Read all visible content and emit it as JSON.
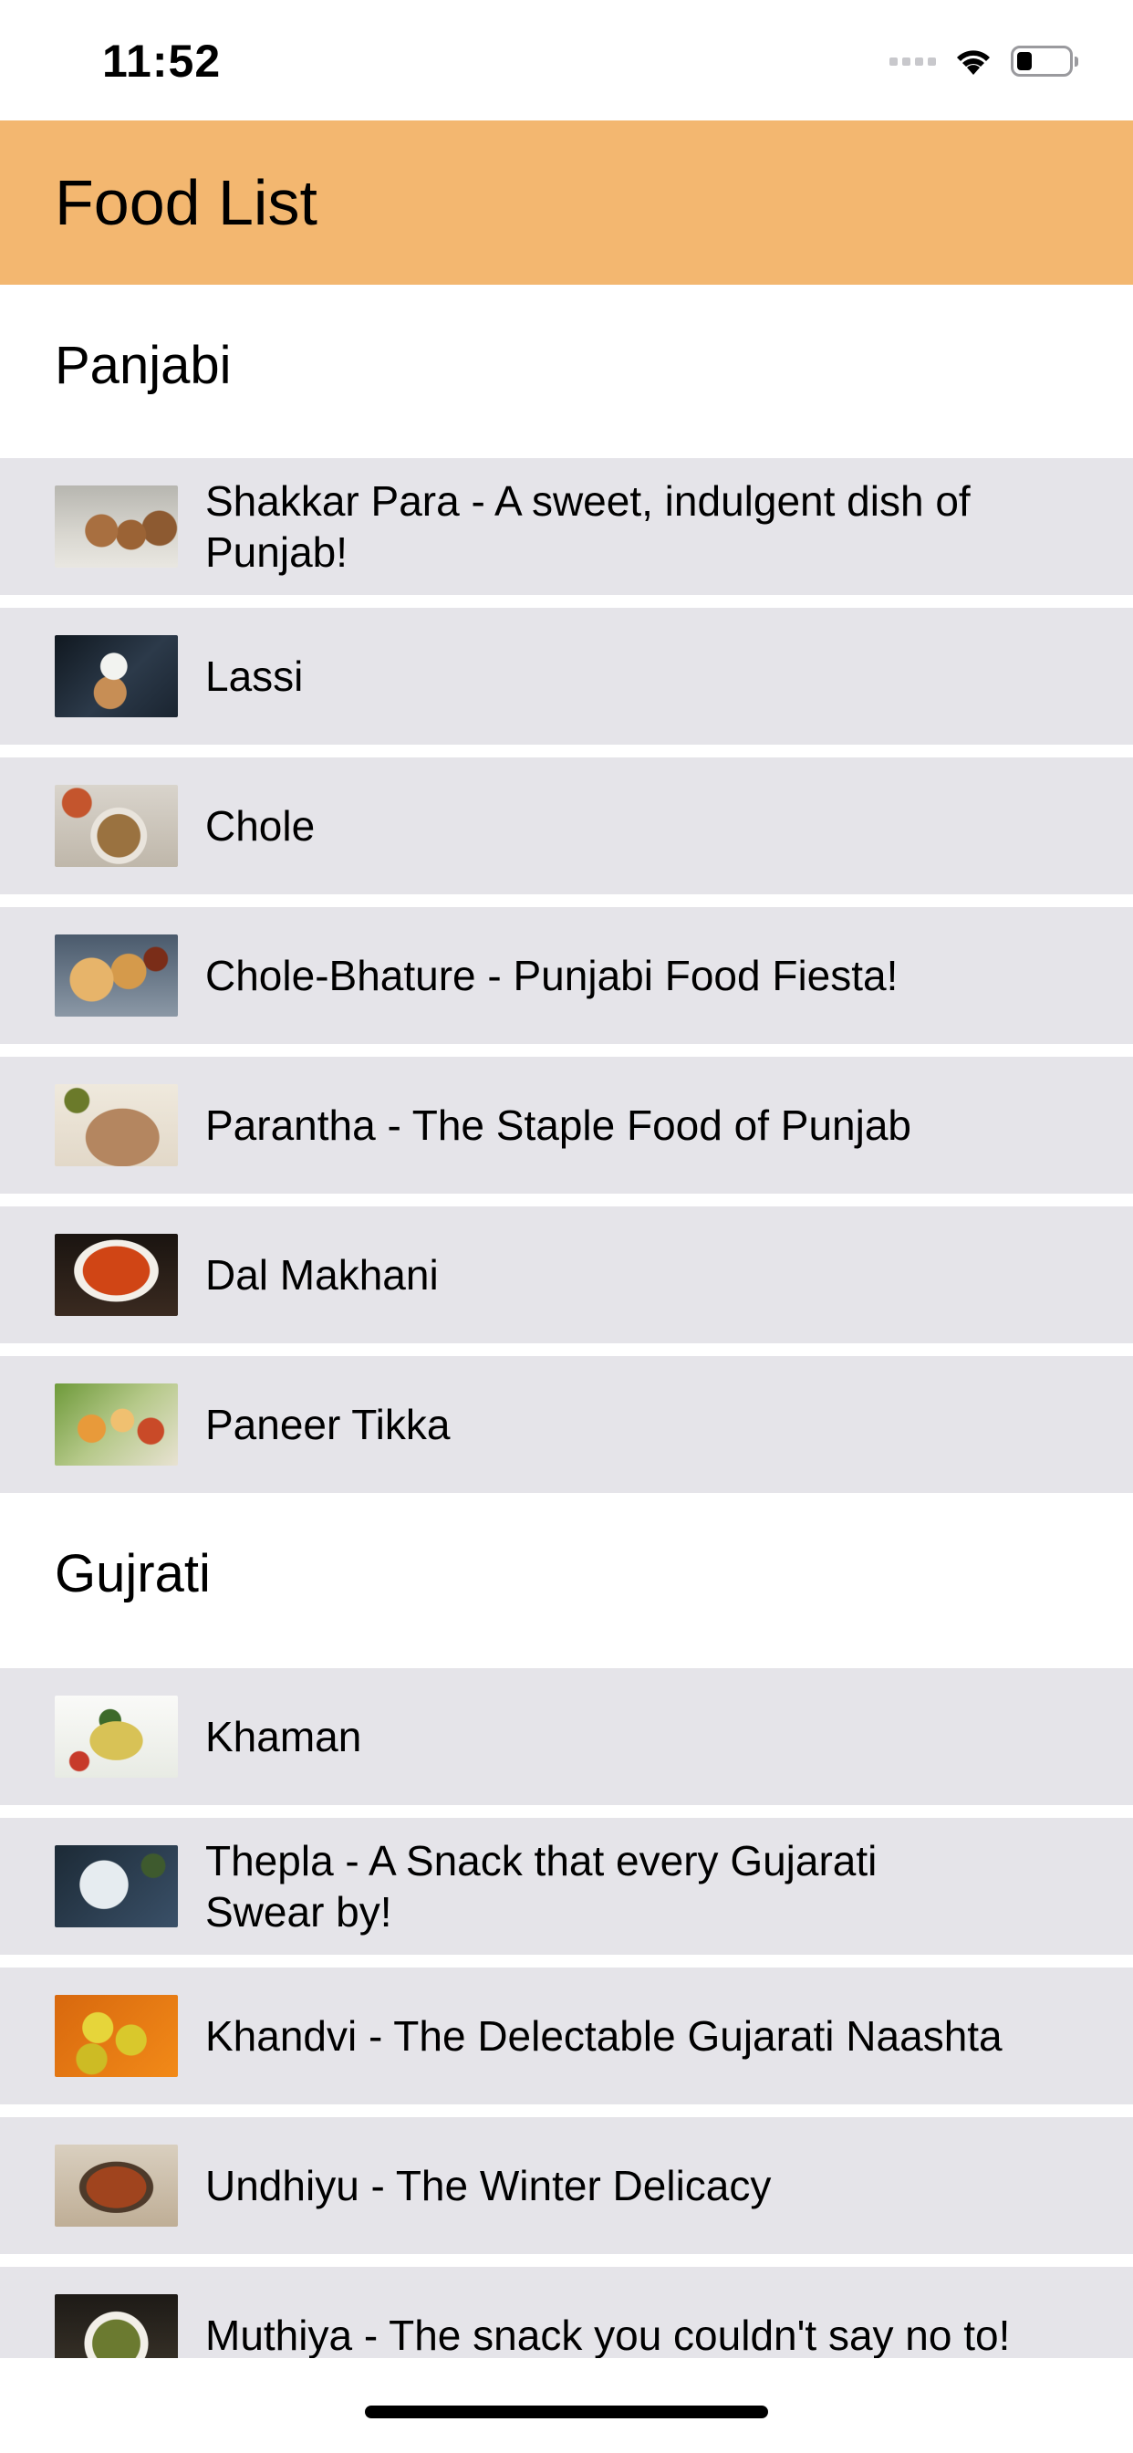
{
  "status_bar": {
    "time": "11:52",
    "battery_level": 0.3
  },
  "header": {
    "title": "Food List",
    "background_color": "#f3b770"
  },
  "sections": [
    {
      "title": "Panjabi",
      "items": [
        {
          "label": "Shakkar Para - A sweet, indulgent dish of Punjab!",
          "image_icon": "shakkar-para-photo"
        },
        {
          "label": "Lassi",
          "image_icon": "lassi-photo"
        },
        {
          "label": "Chole",
          "image_icon": "chole-photo"
        },
        {
          "label": "Chole-Bhature - Punjabi Food Fiesta!",
          "image_icon": "chole-bhature-photo"
        },
        {
          "label": "Parantha - The Staple Food of Punjab",
          "image_icon": "parantha-photo"
        },
        {
          "label": "Dal Makhani",
          "image_icon": "dal-makhani-photo"
        },
        {
          "label": "Paneer Tikka",
          "image_icon": "paneer-tikka-photo"
        }
      ]
    },
    {
      "title": "Gujrati",
      "items": [
        {
          "label": "Khaman",
          "image_icon": "khaman-photo"
        },
        {
          "label": "Thepla - A Snack that every Gujarati Swear by!",
          "image_icon": "thepla-photo"
        },
        {
          "label": "Khandvi - The Delectable Gujarati Naashta",
          "image_icon": "khandvi-photo"
        },
        {
          "label": "Undhiyu - The Winter Delicacy",
          "image_icon": "undhiyu-photo"
        },
        {
          "label": "Muthiya - The snack you couldn't say no to!",
          "image_icon": "muthiya-photo"
        }
      ]
    }
  ],
  "colors": {
    "row_background": "#e5e4e9",
    "page_background": "#ffffff"
  }
}
